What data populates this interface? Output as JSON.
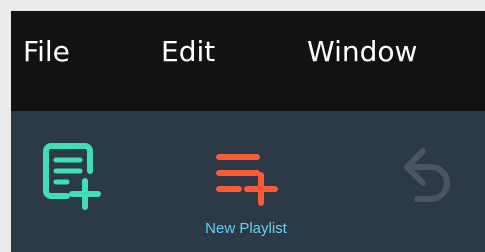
{
  "menubar": {
    "items": [
      {
        "label": "File"
      },
      {
        "label": "Edit"
      },
      {
        "label": "Window"
      }
    ]
  },
  "toolbar": {
    "new_playlist_label": "New Playlist",
    "icons": {
      "new_document": "document-plus-icon",
      "new_playlist": "playlist-plus-icon",
      "undo": "undo-icon"
    }
  },
  "colors": {
    "menubar_bg": "#111214",
    "toolbar_bg": "#2c3946",
    "document_icon": "#3fe0b5",
    "playlist_icon": "#ff5a36",
    "undo_icon_disabled": "#4a5561",
    "label_text": "#5fd4f4"
  }
}
